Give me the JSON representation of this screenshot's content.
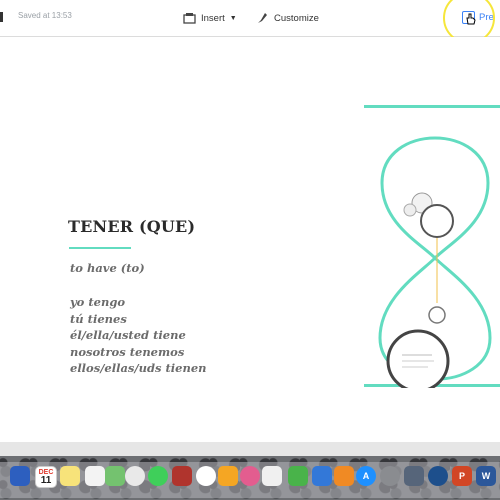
{
  "toolbar": {
    "saved_text": "Saved at 13:53",
    "insert_label": "Insert",
    "customize_label": "Customize",
    "present_label": "Pre"
  },
  "slide": {
    "title": "TENER (QUE)",
    "subtitle": "to have (to)",
    "conjugations": [
      "yo tengo",
      "tú tienes",
      "él/ella/usted tiene",
      "nosotros tenemos",
      "ellos/ellas/uds tienen"
    ],
    "accent_color": "#62dcc0"
  },
  "dock": {
    "calendar_month": "DEC",
    "calendar_day": "11"
  }
}
